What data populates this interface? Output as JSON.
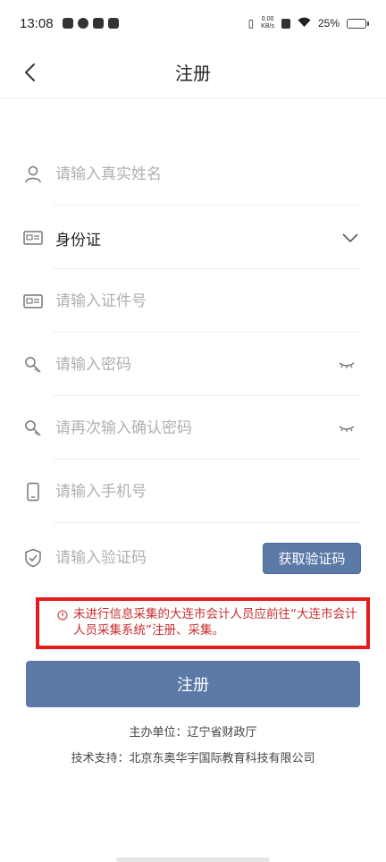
{
  "status_bar": {
    "time": "13:08",
    "net_speed_value": "0.00",
    "net_speed_unit": "KB/s",
    "battery": "25%",
    "battery_level": 0.25
  },
  "header": {
    "title": "注册"
  },
  "form": {
    "name_placeholder": "请输入真实姓名",
    "id_type_value": "身份证",
    "id_number_placeholder": "请输入证件号",
    "password_placeholder": "请输入密码",
    "confirm_password_placeholder": "请再次输入确认密码",
    "phone_placeholder": "请输入手机号",
    "code_placeholder": "请输入验证码",
    "get_code_label": "获取验证码"
  },
  "notice": {
    "text": "未进行信息采集的大连市会计人员应前往“大连市会计人员采集系统”注册、采集。"
  },
  "submit_label": "注册",
  "footer": {
    "host": "主办单位：辽宁省财政厅",
    "tech": "技术支持：北京东奥华宇国际教育科技有限公司"
  },
  "colors": {
    "primary": "#5b7aa7",
    "warning": "#e51c1c"
  }
}
